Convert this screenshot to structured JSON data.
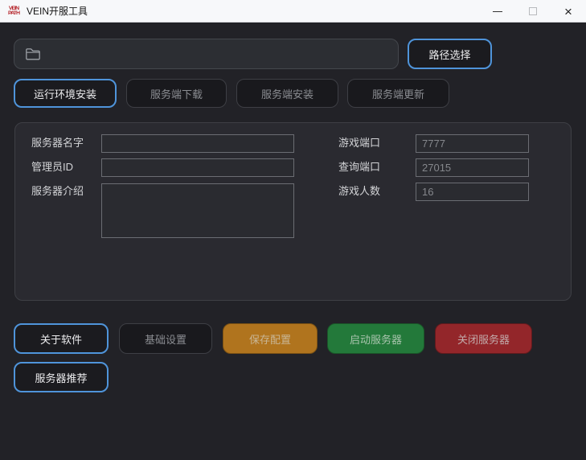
{
  "titlebar": {
    "title": "VEIN开服工具",
    "logo": {
      "line1": "VEIN",
      "line2": "PATH"
    },
    "close_glyph": "×"
  },
  "path_section": {
    "input_value": "",
    "input_placeholder": "",
    "select_button": "路径选择"
  },
  "action_buttons": [
    {
      "label": "运行环境安装",
      "style": "outline-blue"
    },
    {
      "label": "服务端下载",
      "style": "default"
    },
    {
      "label": "服务端安装",
      "style": "default"
    },
    {
      "label": "服务端更新",
      "style": "default"
    }
  ],
  "server_form": {
    "left": [
      {
        "label": "服务器名字",
        "value": ""
      },
      {
        "label": "管理员ID",
        "value": ""
      },
      {
        "label": "服务器介绍",
        "value": ""
      }
    ],
    "right": [
      {
        "label": "游戏端口",
        "value": "7777"
      },
      {
        "label": "查询端口",
        "value": "27015"
      },
      {
        "label": "游戏人数",
        "value": "16"
      }
    ]
  },
  "bottom_buttons": [
    {
      "label": "关于软件",
      "style": "outline-blue"
    },
    {
      "label": "基础设置",
      "style": "default"
    },
    {
      "label": "保存配置",
      "style": "orange"
    },
    {
      "label": "启动服务器",
      "style": "green"
    },
    {
      "label": "关闭服务器",
      "style": "red"
    },
    {
      "label": "服务器推荐",
      "style": "outline-blue"
    }
  ],
  "colors": {
    "accent_blue": "#4f94da",
    "orange": "#b0741e",
    "green": "#23793a",
    "red": "#93262a",
    "logo_red": "#b5252b",
    "window_bg": "#222227",
    "titlebar_bg": "#f7f8fa"
  }
}
